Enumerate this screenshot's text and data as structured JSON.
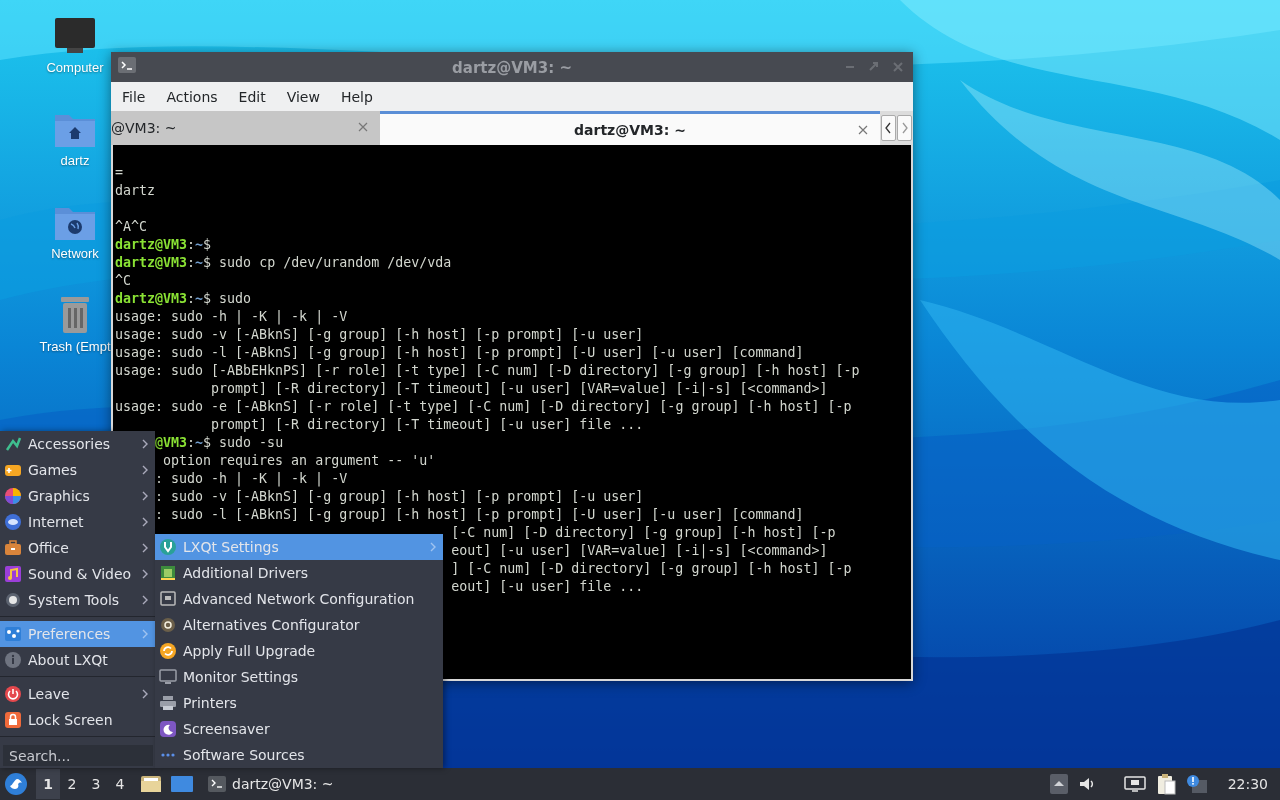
{
  "desktop": {
    "icons": [
      {
        "label": "Computer"
      },
      {
        "label": "dartz"
      },
      {
        "label": "Network"
      },
      {
        "label": "Trash (Empt"
      }
    ]
  },
  "terminal": {
    "title": "dartz@VM3: ~",
    "menu": [
      "File",
      "Actions",
      "Edit",
      "View",
      "Help"
    ],
    "tabs": [
      {
        "label": "@VM3: ~",
        "selected": false
      },
      {
        "label": "dartz@VM3: ~",
        "selected": true
      }
    ],
    "lines": [
      {
        "kind": "out",
        "text": "="
      },
      {
        "kind": "out",
        "text": "dartz"
      },
      {
        "kind": "blank"
      },
      {
        "kind": "out",
        "text": "^A^C"
      },
      {
        "kind": "prompt",
        "user": "dartz@VM3",
        "colon": ":",
        "path": "~",
        "tail": "$"
      },
      {
        "kind": "prompt",
        "user": "dartz@VM3",
        "colon": ":",
        "path": "~",
        "tail": "$ sudo cp /dev/urandom /dev/vda"
      },
      {
        "kind": "out",
        "text": "^C"
      },
      {
        "kind": "prompt",
        "user": "dartz@VM3",
        "colon": ":",
        "path": "~",
        "tail": "$ sudo"
      },
      {
        "kind": "out",
        "text": "usage: sudo -h | -K | -k | -V"
      },
      {
        "kind": "out",
        "text": "usage: sudo -v [-ABknS] [-g group] [-h host] [-p prompt] [-u user]"
      },
      {
        "kind": "out",
        "text": "usage: sudo -l [-ABknS] [-g group] [-h host] [-p prompt] [-U user] [-u user] [command]"
      },
      {
        "kind": "out",
        "text": "usage: sudo [-ABbEHknPS] [-r role] [-t type] [-C num] [-D directory] [-g group] [-h host] [-p"
      },
      {
        "kind": "out",
        "text": "            prompt] [-R directory] [-T timeout] [-u user] [VAR=value] [-i|-s] [<command>]"
      },
      {
        "kind": "out",
        "text": "usage: sudo -e [-ABknS] [-r role] [-t type] [-C num] [-D directory] [-g group] [-h host] [-p"
      },
      {
        "kind": "out",
        "text": "            prompt] [-R directory] [-T timeout] [-u user] file ..."
      },
      {
        "kind": "prompt",
        "user": "     @VM3",
        "colon": ":",
        "path": "~",
        "tail": "$ sudo -su"
      },
      {
        "kind": "out",
        "text": "      option requires an argument -- 'u'"
      },
      {
        "kind": "out",
        "text": "     : sudo -h | -K | -k | -V"
      },
      {
        "kind": "out",
        "text": "     : sudo -v [-ABknS] [-g group] [-h host] [-p prompt] [-u user]"
      },
      {
        "kind": "out",
        "text": "     : sudo -l [-ABknS] [-g group] [-h host] [-p prompt] [-U user] [-u user] [command]"
      },
      {
        "kind": "out",
        "text": "                                          [-C num] [-D directory] [-g group] [-h host] [-p"
      },
      {
        "kind": "out",
        "text": "                                          eout] [-u user] [VAR=value] [-i|-s] [<command>]"
      },
      {
        "kind": "out",
        "text": "                                          ] [-C num] [-D directory] [-g group] [-h host] [-p"
      },
      {
        "kind": "out",
        "text": "                                          eout] [-u user] file ..."
      }
    ]
  },
  "main_menu": {
    "items": [
      {
        "kind": "item",
        "label": "Accessories",
        "submenu": true,
        "selected": false
      },
      {
        "kind": "item",
        "label": "Games",
        "submenu": true,
        "selected": false
      },
      {
        "kind": "item",
        "label": "Graphics",
        "submenu": true,
        "selected": false
      },
      {
        "kind": "item",
        "label": "Internet",
        "submenu": true,
        "selected": false
      },
      {
        "kind": "item",
        "label": "Office",
        "submenu": true,
        "selected": false
      },
      {
        "kind": "item",
        "label": "Sound & Video",
        "submenu": true,
        "selected": false
      },
      {
        "kind": "item",
        "label": "System Tools",
        "submenu": true,
        "selected": false
      },
      {
        "kind": "separator"
      },
      {
        "kind": "item",
        "label": "Preferences",
        "submenu": true,
        "selected": true
      },
      {
        "kind": "item",
        "label": "About LXQt",
        "submenu": false,
        "selected": false
      },
      {
        "kind": "separator"
      },
      {
        "kind": "item",
        "label": "Leave",
        "submenu": true,
        "selected": false
      },
      {
        "kind": "item",
        "label": "Lock Screen",
        "submenu": false,
        "selected": false
      },
      {
        "kind": "separator"
      }
    ],
    "search": {
      "placeholder": "Search..."
    }
  },
  "submenu": {
    "items": [
      {
        "kind": "item",
        "label": "LXQt Settings",
        "submenu": true,
        "selected": true
      },
      {
        "kind": "item",
        "label": "Additional Drivers",
        "submenu": false,
        "selected": false
      },
      {
        "kind": "item",
        "label": "Advanced Network Configuration",
        "submenu": false,
        "selected": false
      },
      {
        "kind": "item",
        "label": "Alternatives Configurator",
        "submenu": false,
        "selected": false
      },
      {
        "kind": "item",
        "label": "Apply Full Upgrade",
        "submenu": false,
        "selected": false
      },
      {
        "kind": "item",
        "label": "Monitor Settings",
        "submenu": false,
        "selected": false
      },
      {
        "kind": "item",
        "label": "Printers",
        "submenu": false,
        "selected": false
      },
      {
        "kind": "item",
        "label": "Screensaver",
        "submenu": false,
        "selected": false
      },
      {
        "kind": "item",
        "label": "Software Sources",
        "submenu": false,
        "selected": false
      }
    ]
  },
  "taskbar": {
    "desktops": [
      {
        "label": "1",
        "selected": true
      },
      {
        "label": "2",
        "selected": false
      },
      {
        "label": "3",
        "selected": false
      },
      {
        "label": "4",
        "selected": false
      }
    ],
    "tasks": [
      {
        "label": "dartz@VM3: ~"
      }
    ],
    "clock": "22:30"
  }
}
